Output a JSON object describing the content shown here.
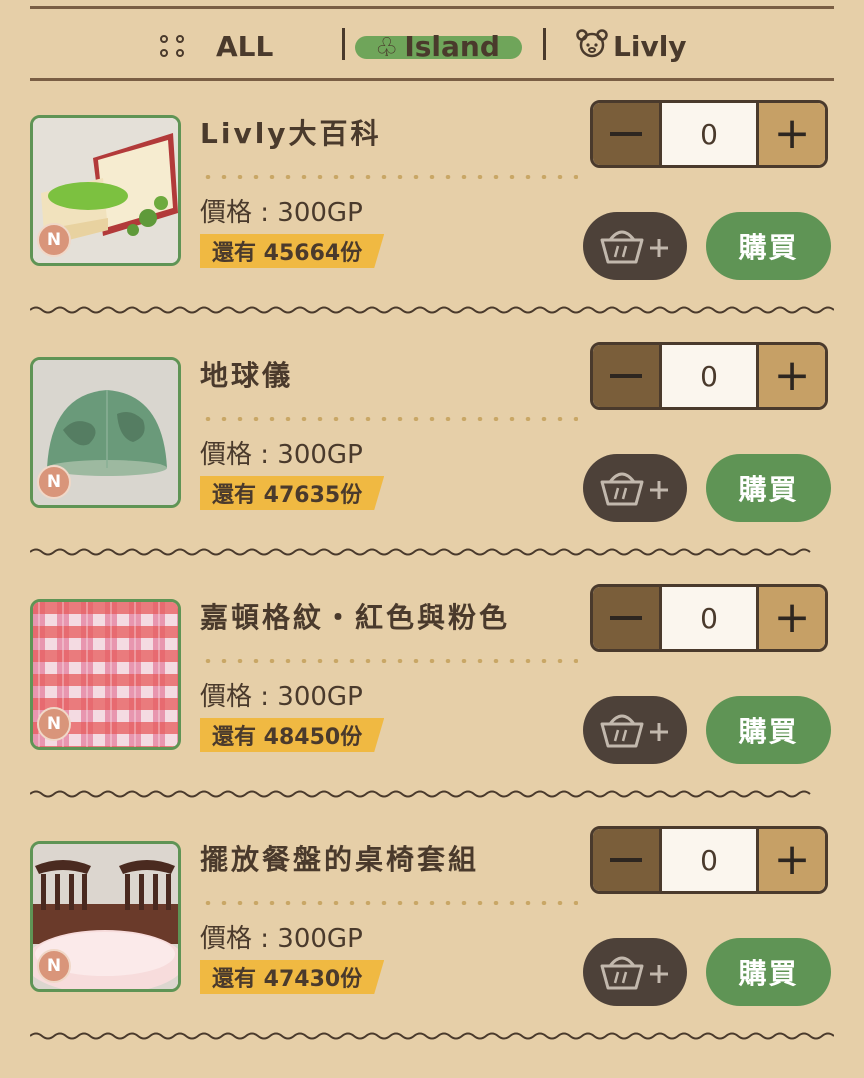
{
  "tabs": [
    {
      "label": "ALL",
      "icon": "dots-grid-icon"
    },
    {
      "label": "Island",
      "icon": "tree-icon",
      "active": true
    },
    {
      "label": "Livly",
      "icon": "livly-face-icon"
    }
  ],
  "items": [
    {
      "name": "Livly大百科",
      "price": "價格 : 300GP",
      "stock": "還有 45664份",
      "quantity": "0",
      "rarity": "N",
      "buy_label": "購買"
    },
    {
      "name": "地球儀",
      "price": "價格 : 300GP",
      "stock": "還有 47635份",
      "quantity": "0",
      "rarity": "N",
      "buy_label": "購買"
    },
    {
      "name": "嘉頓格紋・紅色與粉色",
      "price": "價格 : 300GP",
      "stock": "還有 48450份",
      "quantity": "0",
      "rarity": "N",
      "buy_label": "購買"
    },
    {
      "name": "擺放餐盤的桌椅套組",
      "price": "價格 : 300GP",
      "stock": "還有 47430份",
      "quantity": "0",
      "rarity": "N",
      "buy_label": "購買"
    }
  ],
  "colors": {
    "background": "#e6cfa8",
    "buy": "#5f9455",
    "cart": "#4d4139",
    "stock_tag": "#f0b942"
  }
}
